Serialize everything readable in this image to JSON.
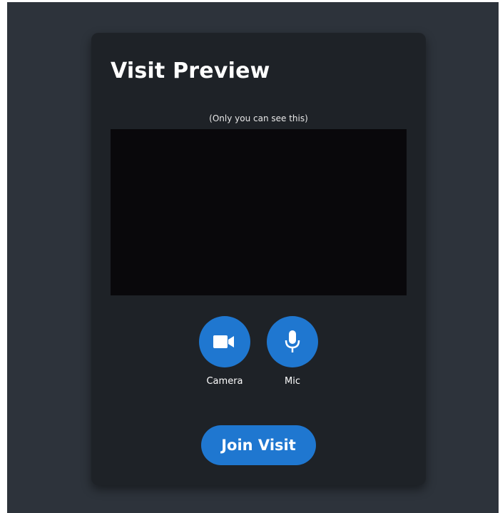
{
  "card": {
    "title": "Visit Preview",
    "note": "(Only you can see this)"
  },
  "controls": {
    "camera": {
      "label": "Camera",
      "icon": "video-camera-icon"
    },
    "mic": {
      "label": "Mic",
      "icon": "microphone-icon"
    }
  },
  "join_button": {
    "label": "Join Visit"
  },
  "colors": {
    "backdrop": "#2d333b",
    "card": "#1e2227",
    "accent": "#1f77d0",
    "video": "#09080b",
    "text": "#ffffff"
  }
}
